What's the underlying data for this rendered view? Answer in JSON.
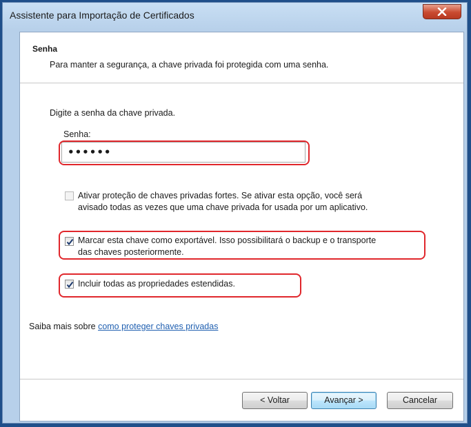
{
  "window": {
    "title": "Assistente para Importação de Certificados",
    "close_icon": "close-icon"
  },
  "header": {
    "title": "Senha",
    "subtitle": "Para manter a segurança, a chave privada foi protegida com uma senha."
  },
  "form": {
    "prompt": "Digite a senha da chave privada.",
    "password_label": "Senha:",
    "password_value": "••••••"
  },
  "options": [
    {
      "line1": "Ativar proteção de chaves privadas fortes. Se ativar esta opção, você será",
      "line2": "avisado todas as vezes que uma chave privada for usada por um aplicativo.",
      "checked": false
    },
    {
      "line1": "Marcar esta chave como exportável. Isso possibilitará o backup e o transporte",
      "line2": "das chaves posteriormente.",
      "checked": true
    },
    {
      "line1": "Incluir todas as propriedades estendidas.",
      "checked": true
    }
  ],
  "learn_more": {
    "prefix": "Saiba mais sobre ",
    "link": "como proteger chaves privadas"
  },
  "buttons": {
    "back": "< Voltar",
    "next": "Avançar >",
    "cancel": "Cancelar"
  },
  "colors": {
    "highlight": "#e0262b",
    "link": "#1f5fb0",
    "titlebar": "#b7d0ea"
  }
}
